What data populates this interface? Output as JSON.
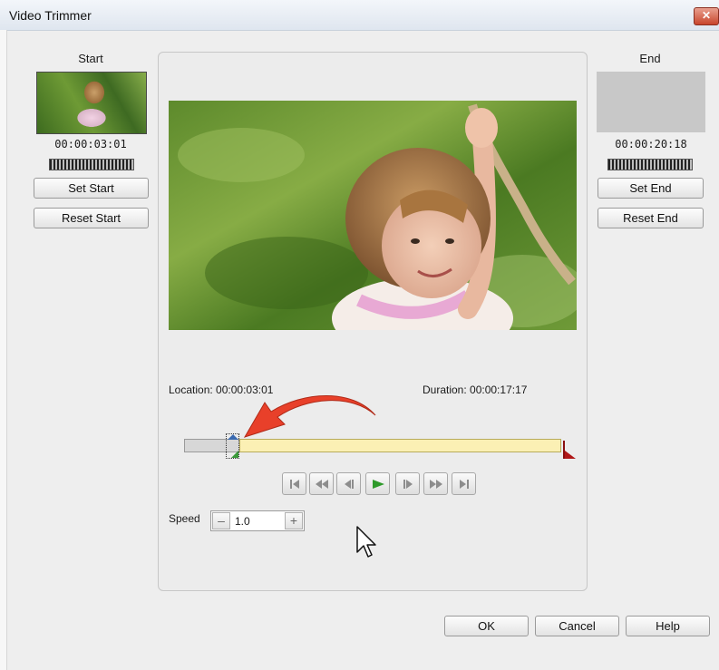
{
  "window": {
    "title": "Video Trimmer",
    "close_label": "✕"
  },
  "start": {
    "heading": "Start",
    "timecode": "00:00:03:01",
    "set_label": "Set Start",
    "reset_label": "Reset Start"
  },
  "end": {
    "heading": "End",
    "timecode": "00:00:20:18",
    "set_label": "Set End",
    "reset_label": "Reset End"
  },
  "player": {
    "location_label": "Location: 00:00:03:01",
    "duration_label": "Duration: 00:00:17:17",
    "controls": [
      "go-to-start",
      "rewind",
      "step-back",
      "play",
      "step-forward",
      "fast-forward",
      "go-to-end"
    ],
    "trim_start_fraction": 0.15,
    "trim_end_fraction": 1.0
  },
  "speed": {
    "label": "Speed",
    "value": "1.0",
    "minus": "–",
    "plus": "+"
  },
  "footer": {
    "ok_label": "OK",
    "cancel_label": "Cancel",
    "help_label": "Help"
  },
  "colors": {
    "accent_arrow": "#e8402a",
    "trim_fill": "#fbf0b4",
    "play_green": "#2e9a2a"
  }
}
